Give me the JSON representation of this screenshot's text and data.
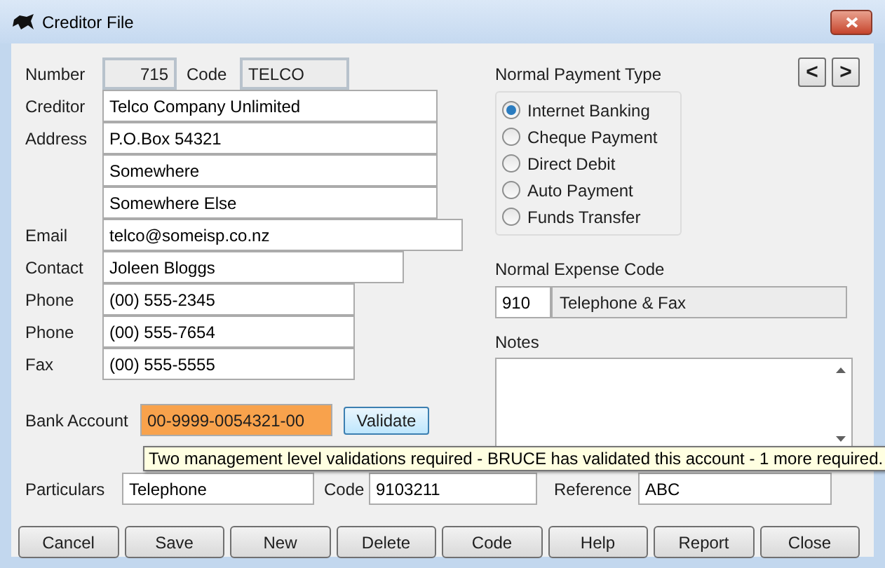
{
  "window": {
    "title": "Creditor File"
  },
  "nav_buttons": [
    "<",
    ">"
  ],
  "number": {
    "label": "Number",
    "value": "715"
  },
  "code": {
    "label": "Code",
    "value": "TELCO"
  },
  "fields": [
    {
      "label": "Creditor",
      "value": "Telco Company Unlimited"
    },
    {
      "label": "Address",
      "value": "P.O.Box 54321"
    },
    {
      "value": "Somewhere"
    },
    {
      "value": "Somewhere Else"
    },
    {
      "label": "Email",
      "value": "telco@someisp.co.nz"
    },
    {
      "label": "Contact",
      "value": "Joleen Bloggs"
    },
    {
      "label": "Phone",
      "value": "(00) 555-2345"
    },
    {
      "label": "Phone",
      "value": "(00) 555-7654"
    },
    {
      "label": "Fax",
      "value": "(00) 555-5555"
    }
  ],
  "payment_type": {
    "label": "Normal Payment Type",
    "options": [
      {
        "label": "Internet Banking",
        "selected": true
      },
      {
        "label": "Cheque Payment",
        "selected": false
      },
      {
        "label": "Direct Debit",
        "selected": false
      },
      {
        "label": "Auto Payment",
        "selected": false
      },
      {
        "label": "Funds Transfer",
        "selected": false
      }
    ]
  },
  "expense_code": {
    "label": "Normal Expense Code",
    "code": "910",
    "description": "Telephone & Fax"
  },
  "notes": {
    "label": "Notes"
  },
  "bank_account": {
    "label": "Bank Account",
    "value": "00-9999-0054321-00",
    "flagged": true,
    "button": "Validate"
  },
  "tooltip": "Two management level validations required - BRUCE has validated this account - 1 more required.",
  "reference_row": [
    {
      "label": "Particulars",
      "value": "Telephone"
    },
    {
      "label": "Code",
      "value": "9103211"
    },
    {
      "label": "Reference",
      "value": "ABC"
    }
  ],
  "buttons": [
    "Cancel",
    "Save",
    "New",
    "Delete",
    "Code",
    "Help",
    "Report",
    "Close"
  ]
}
